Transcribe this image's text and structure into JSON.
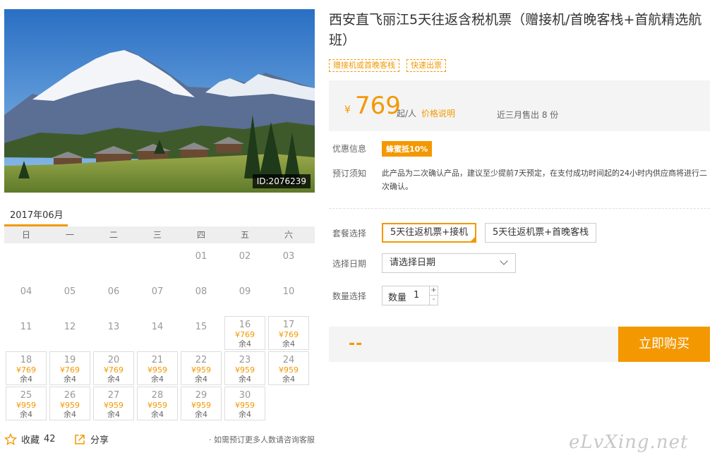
{
  "hero": {
    "image_id": "ID:2076239"
  },
  "calendar": {
    "month_label": "2017年06月",
    "weekdays": [
      "日",
      "一",
      "二",
      "三",
      "四",
      "五",
      "六"
    ],
    "days": [
      {
        "d": "01"
      },
      {
        "d": "02"
      },
      {
        "d": "03"
      },
      {
        "d": "04"
      },
      {
        "d": "05"
      },
      {
        "d": "06"
      },
      {
        "d": "07"
      },
      {
        "d": "08"
      },
      {
        "d": "09"
      },
      {
        "d": "10"
      },
      {
        "d": "11"
      },
      {
        "d": "12"
      },
      {
        "d": "13"
      },
      {
        "d": "14"
      },
      {
        "d": "15"
      },
      {
        "d": "16",
        "price": "¥769",
        "remain": "余4"
      },
      {
        "d": "17",
        "price": "¥769",
        "remain": "余4"
      },
      {
        "d": "18",
        "price": "¥769",
        "remain": "余4"
      },
      {
        "d": "19",
        "price": "¥769",
        "remain": "余4"
      },
      {
        "d": "20",
        "price": "¥769",
        "remain": "余4"
      },
      {
        "d": "21",
        "price": "¥959",
        "remain": "余4"
      },
      {
        "d": "22",
        "price": "¥959",
        "remain": "余4"
      },
      {
        "d": "23",
        "price": "¥959",
        "remain": "余4"
      },
      {
        "d": "24",
        "price": "¥959",
        "remain": "余4"
      },
      {
        "d": "25",
        "price": "¥959",
        "remain": "余4"
      },
      {
        "d": "26",
        "price": "¥959",
        "remain": "余4"
      },
      {
        "d": "27",
        "price": "¥959",
        "remain": "余4"
      },
      {
        "d": "28",
        "price": "¥959",
        "remain": "余4"
      },
      {
        "d": "29",
        "price": "¥959",
        "remain": "余4"
      },
      {
        "d": "30",
        "price": "¥959",
        "remain": "余4"
      }
    ]
  },
  "actions": {
    "favorite_label": "收藏",
    "favorite_count": "42",
    "share_label": "分享",
    "consult_text": "· 如需预订更多人数请咨询客服"
  },
  "product": {
    "title": "西安直飞丽江5天往返含税机票（赠接机/首晚客栈+首航精选航班）",
    "tags": [
      "赠接机或首晚客栈",
      "快速出票"
    ],
    "currency_symbol": "¥",
    "price": "769",
    "price_unit": "起/人",
    "price_link": "价格说明",
    "sold_text": "近三月售出 8 份"
  },
  "discount": {
    "label": "优惠信息",
    "badge": "蜂蜜抵10%"
  },
  "notice": {
    "label": "预订须知",
    "text": "此产品为二次确认产品，建议至少提前7天预定，在支付成功时间起的24小时内供应商将进行二次确认。"
  },
  "package": {
    "label": "套餐选择",
    "options": [
      "5天往返机票+接机",
      "5天往返机票+首晚客栈"
    ],
    "selected_index": 0
  },
  "date": {
    "label": "选择日期",
    "placeholder": "请选择日期"
  },
  "quantity": {
    "label": "数量选择",
    "field_label": "数量",
    "value": "1",
    "plus": "+",
    "minus": "-"
  },
  "buy": {
    "total": "--",
    "button": "立即购买"
  },
  "watermark": "eLvXing.net",
  "colors": {
    "accent": "#f39800",
    "bg_gray": "#f4f4f4"
  }
}
